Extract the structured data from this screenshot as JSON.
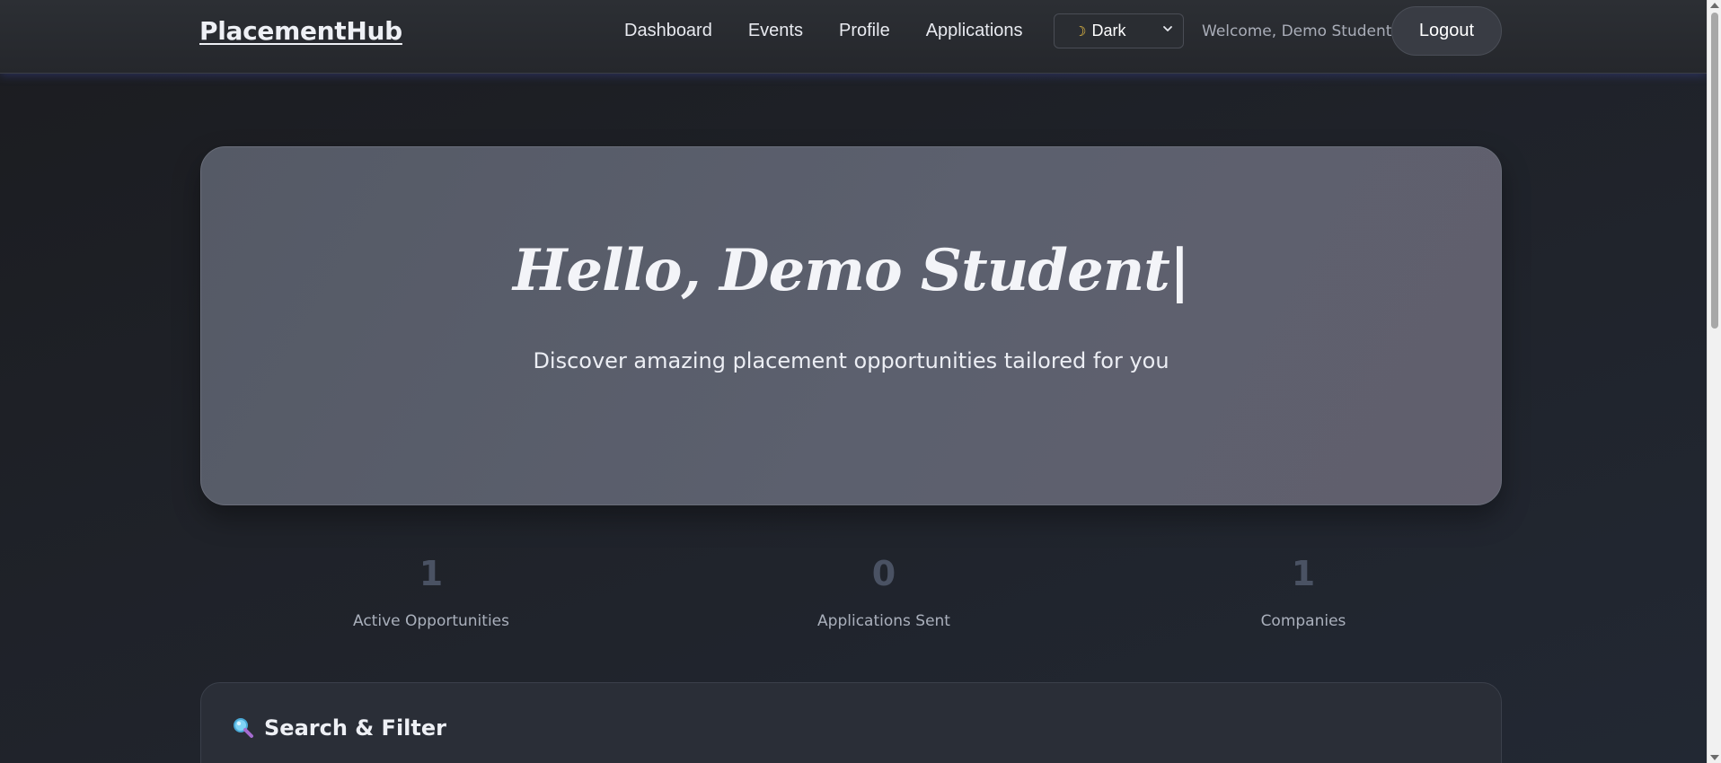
{
  "navbar": {
    "brand": "PlacementHub",
    "links": [
      "Dashboard",
      "Events",
      "Profile",
      "Applications"
    ],
    "theme": {
      "icon": "moon-icon",
      "selected": "Dark"
    },
    "welcome": "Welcome, Demo Student",
    "logout_label": "Logout"
  },
  "hero": {
    "title": "Hello, Demo Student|",
    "subtitle": "Discover amazing placement opportunities tailored for you"
  },
  "stats": [
    {
      "value": "1",
      "label": "Active Opportunities"
    },
    {
      "value": "0",
      "label": "Applications Sent"
    },
    {
      "value": "1",
      "label": "Companies"
    }
  ],
  "filter": {
    "icon": "search-icon",
    "title": "Search & Filter"
  },
  "colors": {
    "background": "#1f2229",
    "hero": "#5a5e6b",
    "accent_glow": "#3c46a0",
    "stat_number": "#4a5263"
  }
}
